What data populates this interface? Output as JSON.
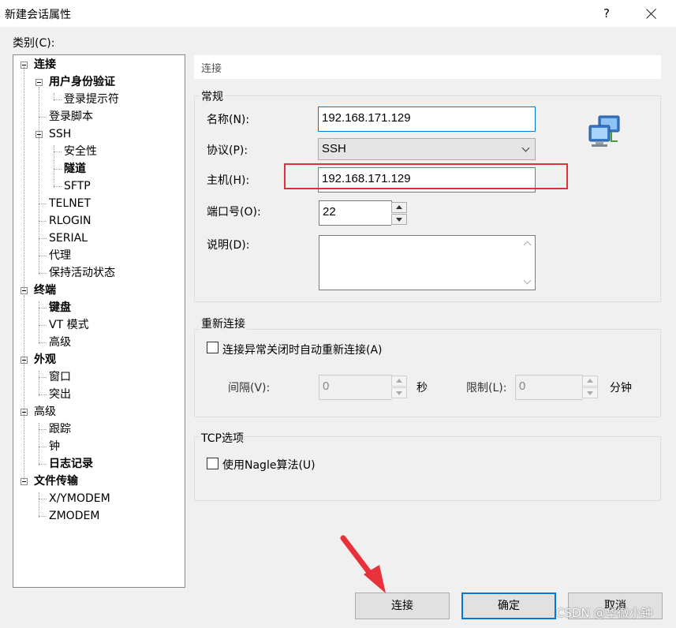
{
  "window": {
    "title": "新建会话属性",
    "help_glyph": "?"
  },
  "category_label": "类别(C):",
  "tree": {
    "items": [
      {
        "label": "连接",
        "bold": true
      },
      {
        "label": "用户身份验证",
        "bold": true
      },
      {
        "label": "登录提示符",
        "bold": false
      },
      {
        "label": "登录脚本",
        "bold": false
      },
      {
        "label": "SSH",
        "bold": false
      },
      {
        "label": "安全性",
        "bold": false
      },
      {
        "label": "隧道",
        "bold": true
      },
      {
        "label": "SFTP",
        "bold": false
      },
      {
        "label": "TELNET",
        "bold": false
      },
      {
        "label": "RLOGIN",
        "bold": false
      },
      {
        "label": "SERIAL",
        "bold": false
      },
      {
        "label": "代理",
        "bold": false
      },
      {
        "label": "保持活动状态",
        "bold": false
      },
      {
        "label": "终端",
        "bold": true
      },
      {
        "label": "键盘",
        "bold": true
      },
      {
        "label": "VT 模式",
        "bold": false
      },
      {
        "label": "高级",
        "bold": false
      },
      {
        "label": "外观",
        "bold": true
      },
      {
        "label": "窗口",
        "bold": false
      },
      {
        "label": "突出",
        "bold": false
      },
      {
        "label": "高级",
        "bold": false
      },
      {
        "label": "跟踪",
        "bold": false
      },
      {
        "label": "钟",
        "bold": false
      },
      {
        "label": "日志记录",
        "bold": true
      },
      {
        "label": "文件传输",
        "bold": true
      },
      {
        "label": "X/YMODEM",
        "bold": false
      },
      {
        "label": "ZMODEM",
        "bold": false
      }
    ]
  },
  "panel": {
    "header": "连接",
    "general": {
      "title": "常规",
      "name_label": "名称(N):",
      "name_value": "192.168.171.129",
      "protocol_label": "协议(P):",
      "protocol_value": "SSH",
      "host_label": "主机(H):",
      "host_value": "192.168.171.129",
      "port_label": "端口号(O):",
      "port_value": "22",
      "desc_label": "说明(D):",
      "desc_value": ""
    },
    "reconnect": {
      "title": "重新连接",
      "auto_label": "连接异常关闭时自动重新连接(A)",
      "interval_label": "间隔(V):",
      "interval_value": "0",
      "interval_unit": "秒",
      "limit_label": "限制(L):",
      "limit_value": "0",
      "limit_unit": "分钟"
    },
    "tcp": {
      "title": "TCP选项",
      "nagle_label": "使用Nagle算法(U)"
    }
  },
  "buttons": {
    "connect": "连接",
    "ok": "确定",
    "cancel": "取消"
  },
  "watermark": "CSDN @华微小钟",
  "colors": {
    "highlight": "#e0303a",
    "accent": "#0078d7",
    "arrow": "#e8313a"
  },
  "icons": {
    "net": "network-computers-icon",
    "arrow": "red-arrow"
  }
}
